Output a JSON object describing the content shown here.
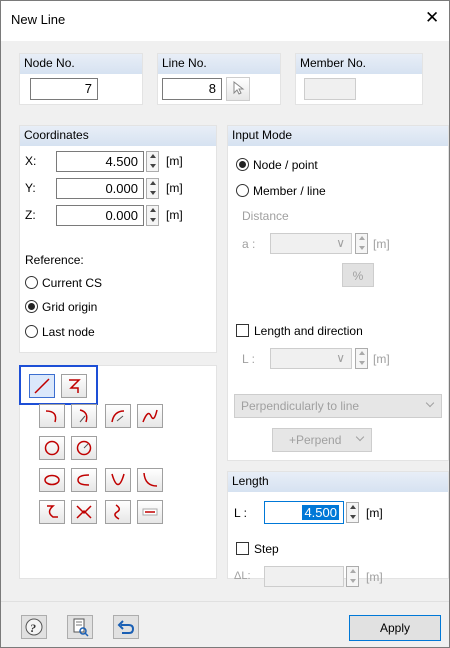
{
  "title": "New Line",
  "close_glyph": "✕",
  "node": {
    "label": "Node No.",
    "value": "7"
  },
  "line": {
    "label": "Line No.",
    "value": "8"
  },
  "member": {
    "label": "Member No.",
    "value": ""
  },
  "coords": {
    "header": "Coordinates",
    "x_label": "X:",
    "x_value": "4.500",
    "y_label": "Y:",
    "y_value": "0.000",
    "z_label": "Z:",
    "z_value": "0.000",
    "unit": "[m]"
  },
  "reference": {
    "label": "Reference:",
    "options": [
      "Current CS",
      "Grid origin",
      "Last node"
    ],
    "selected": "Grid origin"
  },
  "input_mode": {
    "header": "Input Mode",
    "node_point": "Node / point",
    "member_line": "Member / line",
    "distance": "Distance",
    "a_label": "a :",
    "a_value": "",
    "unit": "[m]",
    "percent": "%",
    "length_dir": "Length and direction",
    "l_label": "L :",
    "l_value": "",
    "perp_dropdown": "Perpendicularly to line",
    "perp_button": "+Perpend"
  },
  "length": {
    "header": "Length",
    "l_label": "L :",
    "l_value": "4.500",
    "unit": "[m]",
    "step": "Step",
    "dl_label": "ΔL:",
    "dl_value": "",
    "dl_unit": "[m]"
  },
  "apply": "Apply",
  "colors": {
    "header_bg": "#dce6f4",
    "highlight": "#1d4fd6",
    "line_red": "#c00000"
  }
}
